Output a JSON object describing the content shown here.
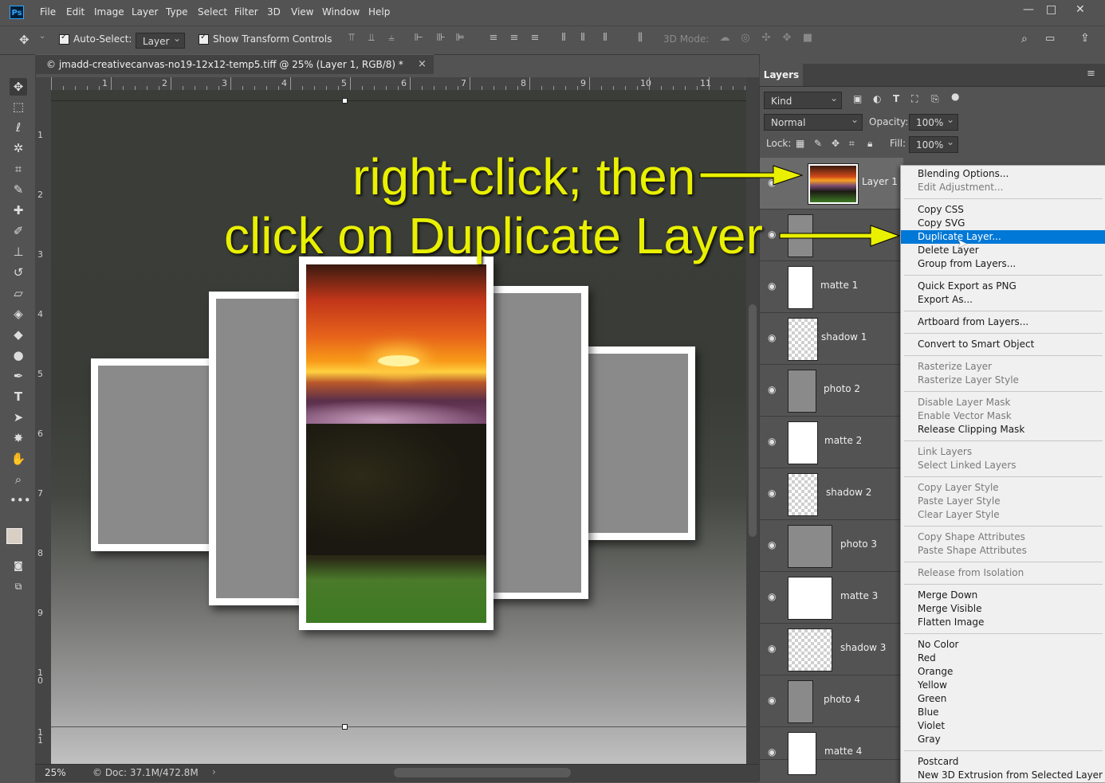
{
  "app": {
    "logo": "Ps"
  },
  "menubar": [
    "File",
    "Edit",
    "Image",
    "Layer",
    "Type",
    "Select",
    "Filter",
    "3D",
    "View",
    "Window",
    "Help"
  ],
  "window_controls": {
    "minimize": "—",
    "maximize": "□",
    "close": "✕"
  },
  "options_bar": {
    "auto_select_label": "Auto-Select:",
    "auto_select_value": "Layer",
    "show_transform_label": "Show Transform Controls",
    "mode_3d_label": "3D Mode:"
  },
  "document": {
    "tab_title": "© jmadd-creativecanvas-no19-12x12-temp5.tiff @ 25% (Layer 1, RGB/8) *",
    "close_glyph": "×"
  },
  "rulers": {
    "top": [
      "1",
      "2",
      "3",
      "4",
      "5",
      "6",
      "7",
      "8",
      "9",
      "10",
      "11"
    ],
    "left": [
      "1",
      "2",
      "3",
      "4",
      "5",
      "6",
      "7",
      "8",
      "9",
      "1\n0",
      "1\n1"
    ]
  },
  "status": {
    "zoom": "25%",
    "doc": "© Doc: 37.1M/472.8M"
  },
  "layers_panel": {
    "tab": "Layers",
    "filter_kind": "Kind",
    "blend_mode": "Normal",
    "opacity_label": "Opacity:",
    "opacity_value": "100%",
    "lock_label": "Lock:",
    "fill_label": "Fill:",
    "fill_value": "100%",
    "layers": [
      {
        "name": "Layer 1",
        "thumb": "photo"
      },
      {
        "name": "",
        "thumb": "gray"
      },
      {
        "name": "matte 1",
        "thumb": "white"
      },
      {
        "name": "shadow 1",
        "thumb": "check"
      },
      {
        "name": "photo 2",
        "thumb": "gray"
      },
      {
        "name": "matte 2",
        "thumb": "white"
      },
      {
        "name": "shadow 2",
        "thumb": "check"
      },
      {
        "name": "photo 3",
        "thumb": "gray"
      },
      {
        "name": "matte 3",
        "thumb": "white"
      },
      {
        "name": "shadow 3",
        "thumb": "check"
      },
      {
        "name": "photo 4",
        "thumb": "gray"
      },
      {
        "name": "matte 4",
        "thumb": "white"
      }
    ]
  },
  "context_menu": {
    "groups": [
      [
        {
          "label": "Blending Options...",
          "enabled": true
        },
        {
          "label": "Edit Adjustment...",
          "enabled": false
        }
      ],
      [
        {
          "label": "Copy CSS",
          "enabled": true
        },
        {
          "label": "Copy SVG",
          "enabled": true
        },
        {
          "label": "Duplicate Layer...",
          "enabled": true,
          "highlighted": true
        },
        {
          "label": "Delete Layer",
          "enabled": true
        },
        {
          "label": "Group from Layers...",
          "enabled": true
        }
      ],
      [
        {
          "label": "Quick Export as PNG",
          "enabled": true
        },
        {
          "label": "Export As...",
          "enabled": true
        }
      ],
      [
        {
          "label": "Artboard from Layers...",
          "enabled": true
        }
      ],
      [
        {
          "label": "Convert to Smart Object",
          "enabled": true
        }
      ],
      [
        {
          "label": "Rasterize Layer",
          "enabled": false
        },
        {
          "label": "Rasterize Layer Style",
          "enabled": false
        }
      ],
      [
        {
          "label": "Disable Layer Mask",
          "enabled": false
        },
        {
          "label": "Enable Vector Mask",
          "enabled": false
        },
        {
          "label": "Release Clipping Mask",
          "enabled": true
        }
      ],
      [
        {
          "label": "Link Layers",
          "enabled": false
        },
        {
          "label": "Select Linked Layers",
          "enabled": false
        }
      ],
      [
        {
          "label": "Copy Layer Style",
          "enabled": false
        },
        {
          "label": "Paste Layer Style",
          "enabled": false
        },
        {
          "label": "Clear Layer Style",
          "enabled": false
        }
      ],
      [
        {
          "label": "Copy Shape Attributes",
          "enabled": false
        },
        {
          "label": "Paste Shape Attributes",
          "enabled": false
        }
      ],
      [
        {
          "label": "Release from Isolation",
          "enabled": false
        }
      ],
      [
        {
          "label": "Merge Down",
          "enabled": true
        },
        {
          "label": "Merge Visible",
          "enabled": true
        },
        {
          "label": "Flatten Image",
          "enabled": true
        }
      ],
      [
        {
          "label": "No Color",
          "enabled": true
        },
        {
          "label": "Red",
          "enabled": true
        },
        {
          "label": "Orange",
          "enabled": true
        },
        {
          "label": "Yellow",
          "enabled": true
        },
        {
          "label": "Green",
          "enabled": true
        },
        {
          "label": "Blue",
          "enabled": true
        },
        {
          "label": "Violet",
          "enabled": true
        },
        {
          "label": "Gray",
          "enabled": true
        }
      ],
      [
        {
          "label": "Postcard",
          "enabled": true
        },
        {
          "label": "New 3D Extrusion from Selected Layer",
          "enabled": true
        }
      ]
    ]
  },
  "annotation": {
    "line1": "right-click; then",
    "line2": "click on Duplicate Layer",
    "color": "#e9f000"
  },
  "colors": {
    "accent": "#0078d7",
    "panel": "#535353",
    "canvas_dark": "#3b3d38"
  }
}
